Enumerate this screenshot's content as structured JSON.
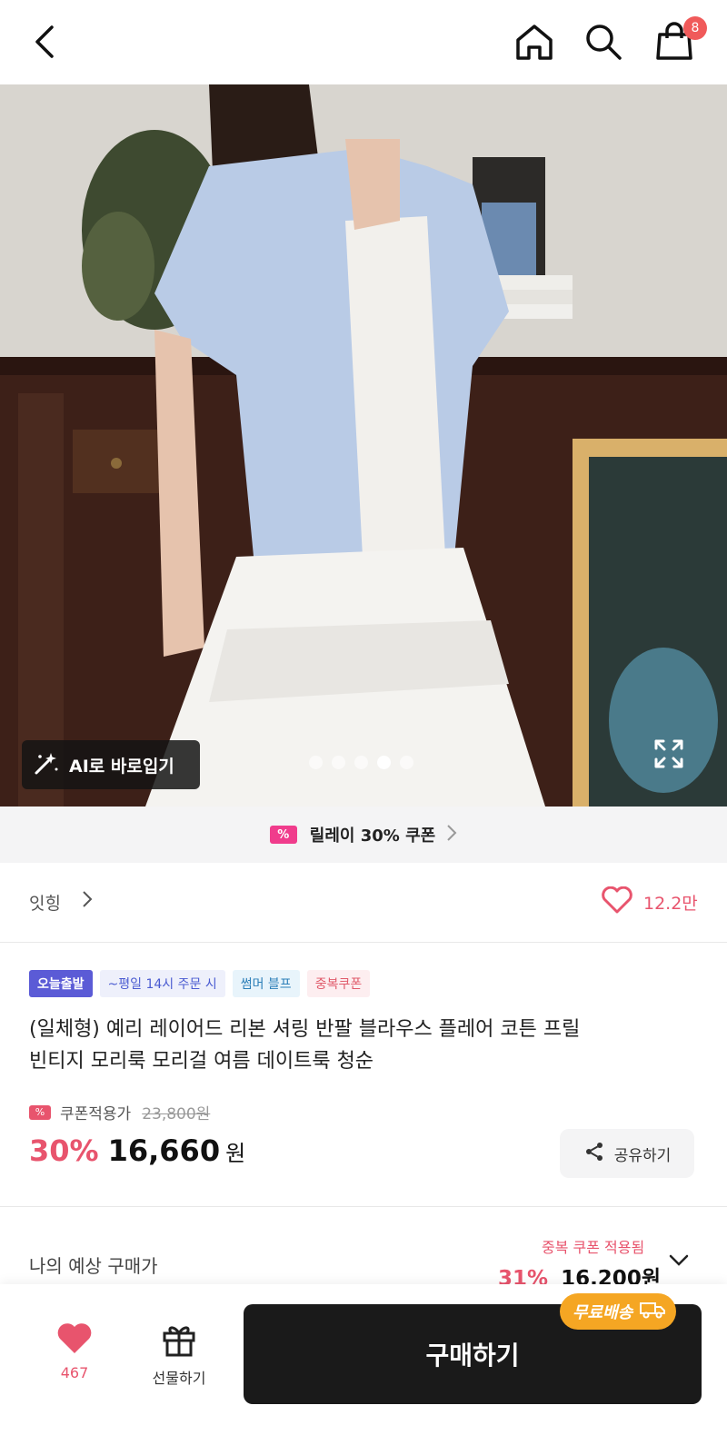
{
  "header": {
    "cart_count": "8"
  },
  "hero": {
    "ai_button_label": "AI로 바로입기",
    "slide_count": 5,
    "active_slide": 4
  },
  "coupon_banner": {
    "label": "릴레이 30% 쿠폰"
  },
  "brand": {
    "name": "잇힝",
    "like_count": "12.2만"
  },
  "badges": [
    "오늘출발",
    "~평일 14시 주문 시",
    "썸머 블프",
    "중복쿠폰"
  ],
  "product": {
    "title_line1": "(일체형) 예리 레이어드 리본 셔링 반팔 블라우스 플레어 코튼 프릴",
    "title_line2": "빈티지 모리룩 모리걸 여름 데이트룩 청순",
    "coupon_price_label": "쿠폰적용가",
    "original_price": "23,800원",
    "discount": "30%",
    "price": "16,660",
    "currency": "원",
    "share_label": "공유하기"
  },
  "estimate": {
    "label": "나의 예상 구매가",
    "note": "중복 쿠폰 적용됨",
    "discount": "31%",
    "price": "16,200원"
  },
  "bottom_bar": {
    "like_count": "467",
    "gift_label": "선물하기",
    "buy_label": "구매하기",
    "free_shipping_label": "무료배송"
  },
  "colors": {
    "accent_pink": "#e8546d",
    "buy_button": "#1a1a1a",
    "free_shipping": "#f5a623",
    "badge_today": "#5b5bd6"
  }
}
